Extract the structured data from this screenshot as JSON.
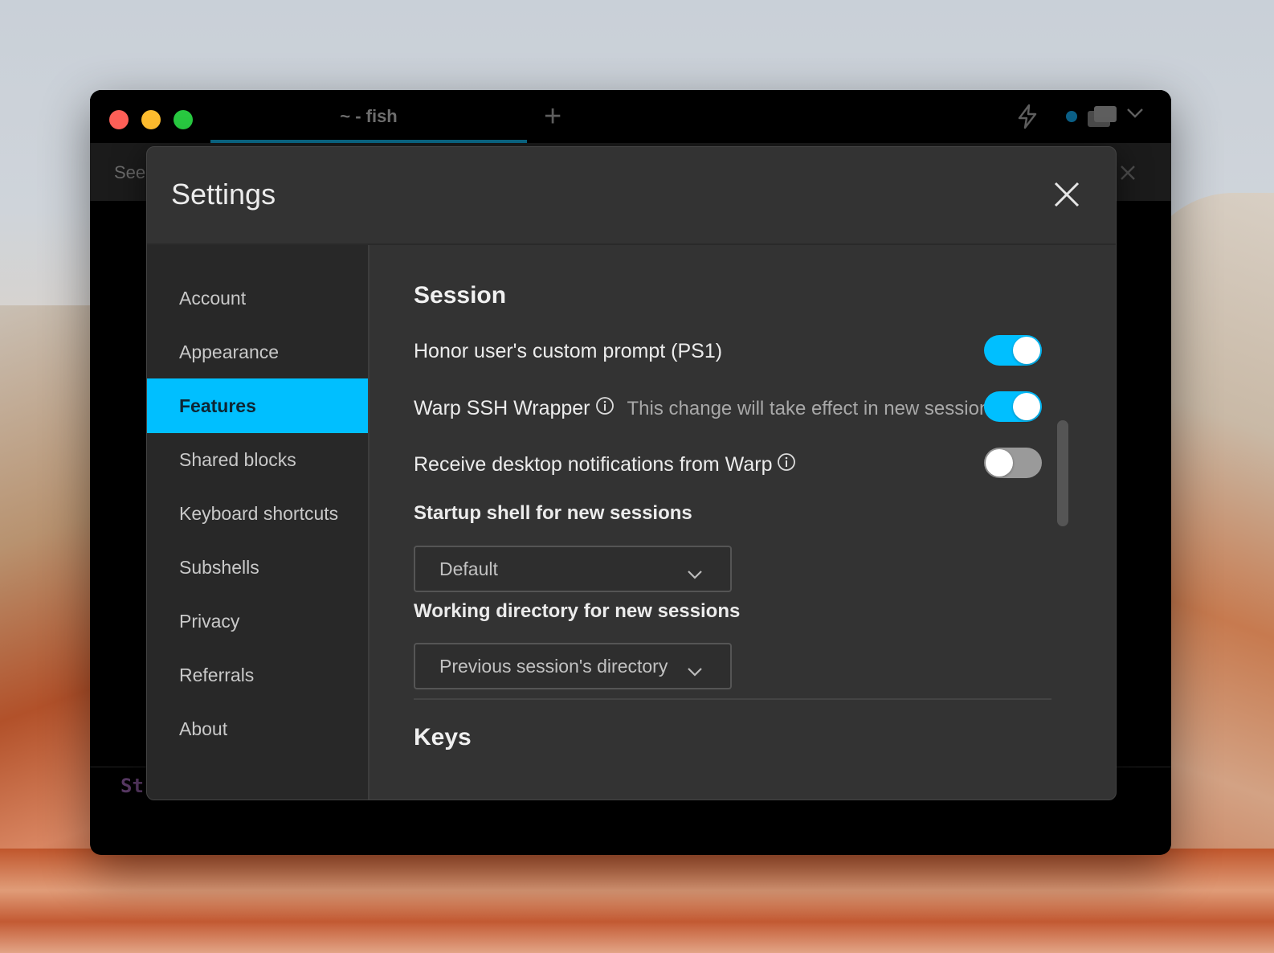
{
  "window": {
    "tab_title": "~ - fish",
    "new_tab_symbol": "+",
    "banner_text": "See",
    "prompt_text": "St"
  },
  "settings": {
    "title": "Settings",
    "sidebar": [
      {
        "label": "Account",
        "active": false
      },
      {
        "label": "Appearance",
        "active": false
      },
      {
        "label": "Features",
        "active": true
      },
      {
        "label": "Shared blocks",
        "active": false
      },
      {
        "label": "Keyboard shortcuts",
        "active": false
      },
      {
        "label": "Subshells",
        "active": false
      },
      {
        "label": "Privacy",
        "active": false
      },
      {
        "label": "Referrals",
        "active": false
      },
      {
        "label": "About",
        "active": false
      }
    ],
    "session": {
      "heading": "Session",
      "honor_prompt": {
        "label": "Honor user's custom prompt (PS1)",
        "enabled": true
      },
      "ssh_wrapper": {
        "label": "Warp SSH Wrapper",
        "hint": "This change will take effect in new sessions",
        "enabled": true
      },
      "notifications": {
        "label": "Receive desktop notifications from Warp",
        "enabled": false
      },
      "startup_shell": {
        "label": "Startup shell for new sessions",
        "value": "Default"
      },
      "working_dir": {
        "label": "Working directory for new sessions",
        "value": "Previous session's directory"
      }
    },
    "keys": {
      "heading": "Keys"
    }
  },
  "colors": {
    "accent": "#00bfff",
    "modal_bg": "#333333",
    "sidebar_bg": "#282828"
  },
  "icons": {
    "close": "close-icon",
    "info": "info-icon",
    "chevron": "chevron-down-icon",
    "bolt": "lightning-icon"
  }
}
